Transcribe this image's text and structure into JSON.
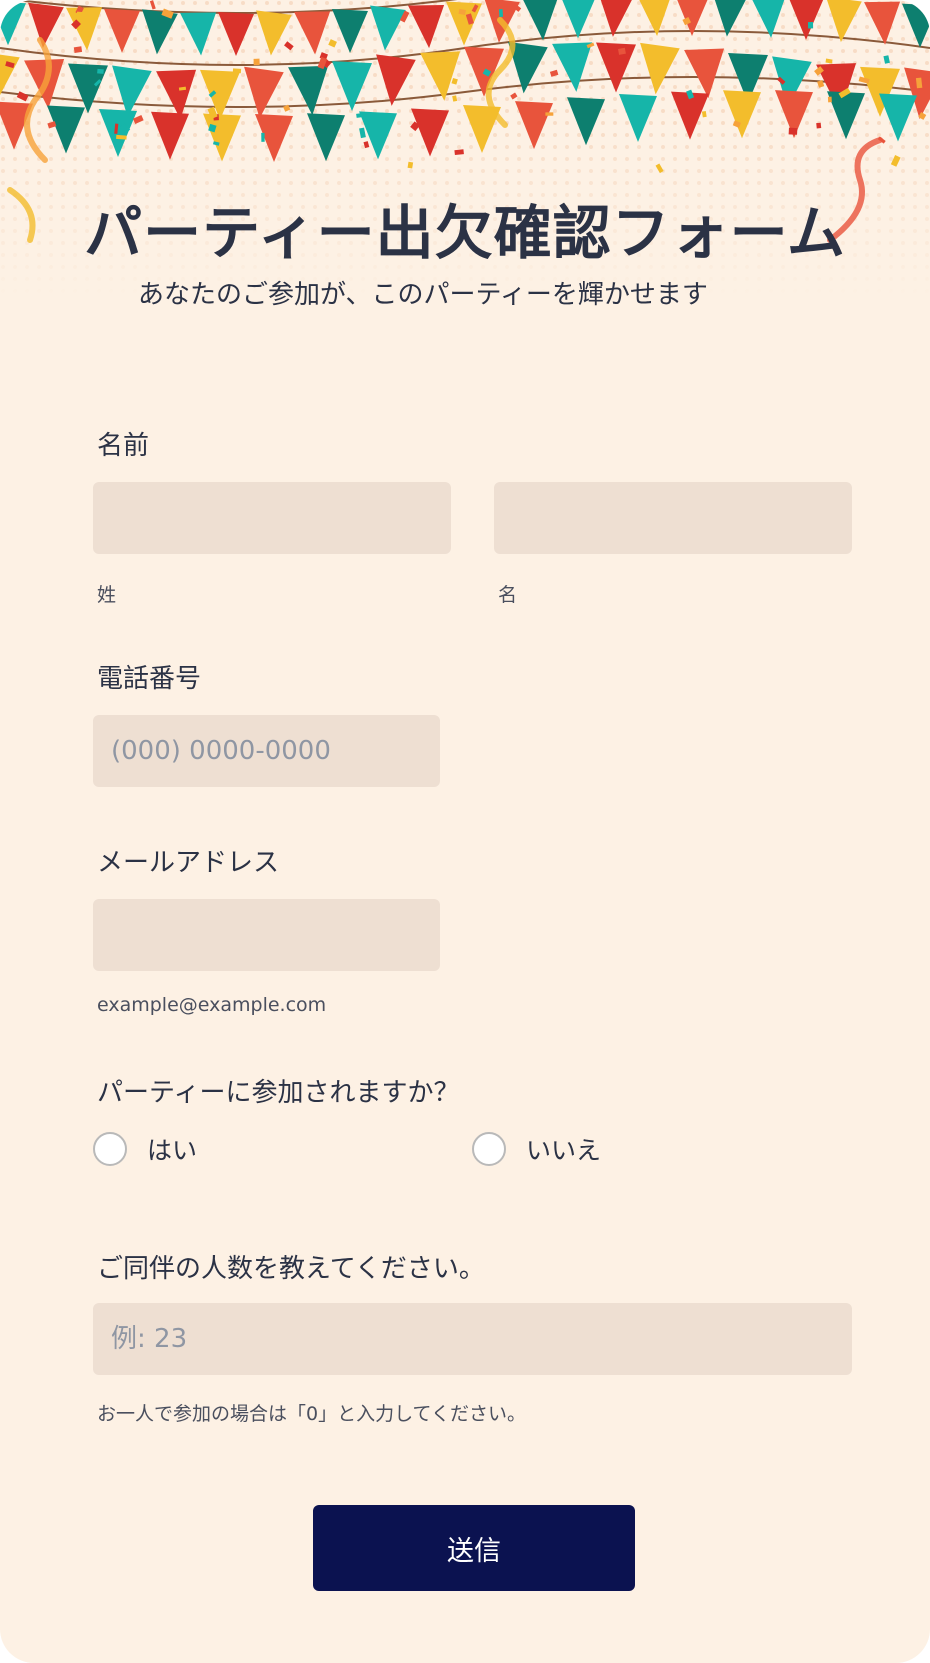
{
  "header": {
    "title": "パーティー出欠確認フォーム",
    "subtitle": "あなたのご参加が、このパーティーを輝かせます"
  },
  "colors": {
    "background": "#fdf1e4",
    "field": "#eedfd2",
    "text": "#2b3245",
    "button": "#0b1250",
    "bunting": [
      "#16b5a9",
      "#d9322b",
      "#f3bd2c",
      "#e8543c",
      "#0d7f6f"
    ]
  },
  "form": {
    "name": {
      "label": "名前",
      "last_name": {
        "value": "",
        "sublabel": "姓"
      },
      "first_name": {
        "value": "",
        "sublabel": "名"
      }
    },
    "phone": {
      "label": "電話番号",
      "placeholder": "(000) 0000-0000",
      "value": ""
    },
    "email": {
      "label": "メールアドレス",
      "value": "",
      "sublabel": "example@example.com"
    },
    "attendance": {
      "question": "パーティーに参加されますか？",
      "options": [
        "はい",
        "いいえ"
      ],
      "selected": ""
    },
    "companions": {
      "label": "ご同伴の人数を教えてください。",
      "placeholder": "例: 23",
      "value": "",
      "hint": "お一人で参加の場合は「0」と入力してください。"
    },
    "submit_label": "送信"
  }
}
